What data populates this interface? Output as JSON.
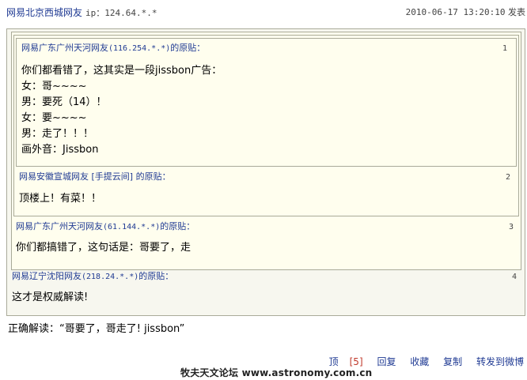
{
  "header": {
    "user": "网易北京西城网友",
    "ip": "ip：124.64.*.*",
    "datetime": "2010-06-17 13:20:10",
    "post_label": "发表"
  },
  "quotes": [
    {
      "floor": "1",
      "user": "网易广东广州天河网友",
      "ip": "(116.254.*.*)",
      "suffix": "的原贴：",
      "lines": [
        "你们都看错了，这其实是一段jissbon广告：",
        "女：哥~~~~",
        "男：要死（14）！",
        "女：要~~~~",
        "男：走了！！！",
        "画外音：Jissbon"
      ]
    },
    {
      "floor": "2",
      "user": "网易安徽宣城网友",
      "ip": " [手提云间]",
      "suffix": " 的原贴：",
      "lines": [
        "顶楼上！有菜！！"
      ]
    },
    {
      "floor": "3",
      "user": "网易广东广州天河网友",
      "ip": "(61.144.*.*)",
      "suffix": "的原贴：",
      "lines": [
        "你们都搞错了，这句话是：哥要了，走"
      ]
    },
    {
      "floor": "4",
      "user": "网易辽宁沈阳网友",
      "ip": "(218.24.*.*)",
      "suffix": "的原贴：",
      "lines": [
        "这才是权威解读!"
      ]
    }
  ],
  "final_text": "正确解读：“哥要了，哥走了! jissbon”",
  "actions": {
    "top_label": "顶",
    "top_count": "[5]",
    "reply": "回复",
    "favorite": "收藏",
    "copy": "复制",
    "forward": "转发到微博"
  },
  "watermark": "牧夫天文论坛 www.astronomy.com.cn",
  "colors": {
    "link": "#1f3a93",
    "quote_bg": "#fffeee",
    "quote_border": "#a9aa99",
    "count": "#c0392b"
  }
}
